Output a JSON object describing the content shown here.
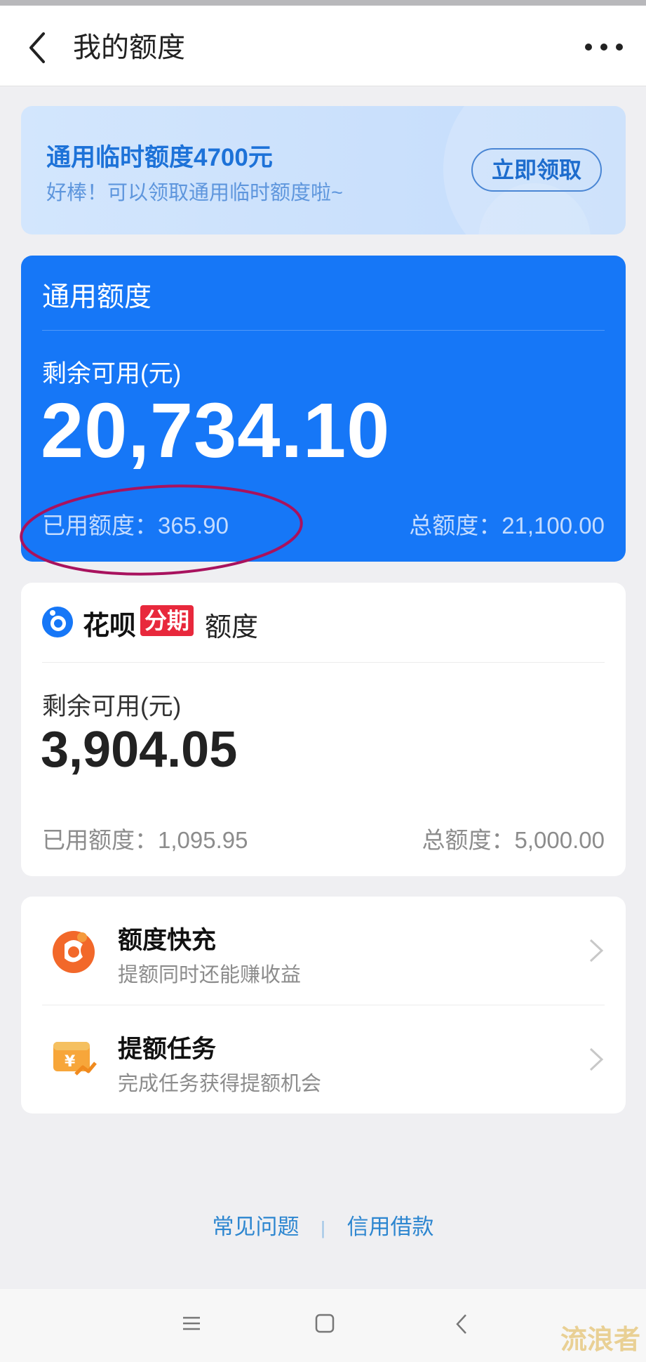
{
  "header": {
    "title": "我的额度",
    "back_icon": "chevron-left-icon",
    "more_icon": "more-dots-icon"
  },
  "promo": {
    "title": "通用临时额度4700元",
    "subtitle": "好棒！可以领取通用临时额度啦~",
    "button_label": "立即领取"
  },
  "general_quota": {
    "title": "通用额度",
    "available_label": "剩余可用(元)",
    "available_amount": "20,734.10",
    "used_text": "已用额度：365.90",
    "total_text": "总额度：21,100.00",
    "accent_color": "#1677f7"
  },
  "huabei_quota": {
    "brand": "花呗",
    "tag": "分期",
    "suffix": "额度",
    "available_label": "剩余可用(元)",
    "available_amount": "3,904.05",
    "used_text": "已用额度：1,095.95",
    "total_text": "总额度：5,000.00",
    "tag_color": "#e8283c"
  },
  "actions": [
    {
      "title": "额度快充",
      "subtitle": "提额同时还能赚收益",
      "icon": "quota-recharge-icon"
    },
    {
      "title": "提额任务",
      "subtitle": "完成任务获得提额机会",
      "icon": "quota-task-icon"
    }
  ],
  "footer": {
    "faq_link": "常见问题",
    "separator": "|",
    "loan_link": "信用借款"
  },
  "watermark": "流浪者"
}
